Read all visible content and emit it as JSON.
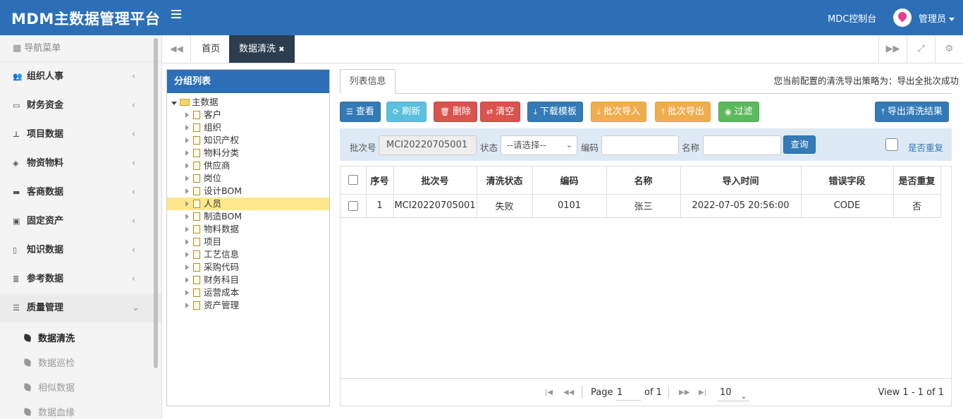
{
  "header": {
    "brand": "MDM主数据管理平台",
    "console": "MDC控制台",
    "user": "管理员"
  },
  "sidebar": {
    "nav_label": "导航菜单",
    "items": [
      {
        "label": "组织人事",
        "icon": "users-icon"
      },
      {
        "label": "财务资金",
        "icon": "credit-card-icon"
      },
      {
        "label": "项目数据",
        "icon": "sitemap-icon"
      },
      {
        "label": "物资物料",
        "icon": "cubes-icon"
      },
      {
        "label": "客商数据",
        "icon": "briefcase-icon"
      },
      {
        "label": "固定资产",
        "icon": "building-icon"
      },
      {
        "label": "知识数据",
        "icon": "book-icon"
      },
      {
        "label": "参考数据",
        "icon": "list-icon"
      },
      {
        "label": "质量管理",
        "icon": "tasks-icon"
      }
    ],
    "sub_items": [
      {
        "label": "数据清洗",
        "active": true
      },
      {
        "label": "数据巡检",
        "active": false
      },
      {
        "label": "相似数据",
        "active": false
      },
      {
        "label": "数据血缘",
        "active": false
      }
    ]
  },
  "tabs": {
    "home": "首页",
    "current": "数据清洗",
    "close": "✖"
  },
  "group_panel": {
    "title": "分组列表",
    "root": "主数据",
    "nodes": [
      "客户",
      "组织",
      "知识产权",
      "物料分类",
      "供应商",
      "岗位",
      "设计BOM",
      "人员",
      "制造BOM",
      "物料数据",
      "项目",
      "工艺信息",
      "采购代码",
      "财务科目",
      "运营成本",
      "资产管理"
    ],
    "selected": "人员"
  },
  "content": {
    "tab_label": "列表信息",
    "policy": "您当前配置的清洗导出策略为：导出全批次成功",
    "buttons": {
      "view": "查看",
      "refresh": "刷新",
      "delete": "删除",
      "clear": "清空",
      "download": "下载模板",
      "batch_import": "批次导入",
      "batch_export": "批次导出",
      "filter": "过滤",
      "export_result": "导出清洗结果"
    },
    "search": {
      "batch_label": "批次号",
      "batch_value": "MCI20220705001",
      "status_label": "状态",
      "status_value": "--请选择--",
      "code_label": "编码",
      "name_label": "名称",
      "query": "查询",
      "duplicate_label": "是否重复"
    },
    "table": {
      "columns": [
        "序号",
        "批次号",
        "清洗状态",
        "编码",
        "名称",
        "导入时间",
        "错误字段",
        "是否重复"
      ],
      "rows": [
        [
          "1",
          "MCI20220705001",
          "失败",
          "0101",
          "张三",
          "2022-07-05 20:56:00",
          "CODE",
          "否"
        ]
      ]
    },
    "pager": {
      "page_label": "Page",
      "page": "1",
      "of": "of 1",
      "size": "10",
      "view": "View 1 - 1 of 1"
    }
  }
}
